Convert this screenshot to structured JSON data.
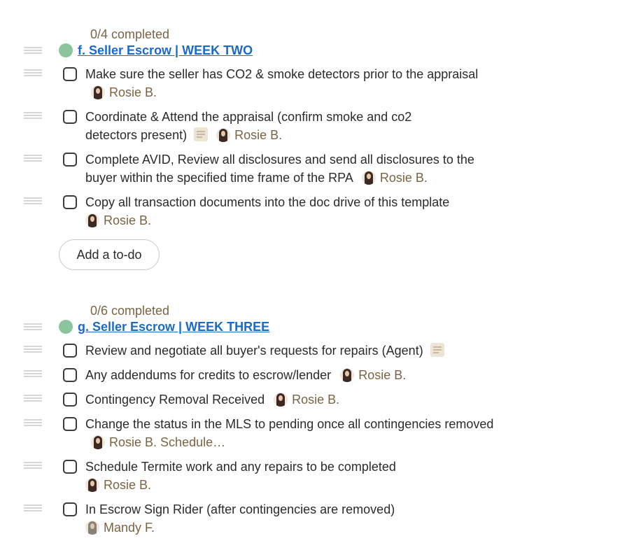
{
  "groups": [
    {
      "progress": "0/4 completed",
      "title": "f. Seller Escrow | WEEK TWO",
      "add_todo_label": "Add a to-do",
      "todos": [
        {
          "text": "Make sure the seller has CO2 & smoke detectors prior to the appraisal",
          "assignee": "Rosie B.",
          "has_note": false
        },
        {
          "text": "Coordinate & Attend the appraisal (confirm smoke and co2 detectors present)",
          "assignee": "Rosie B.",
          "has_note": true
        },
        {
          "text": "Complete AVID, Review all disclosures and send all disclosures to the buyer within the specified time frame of the RPA",
          "assignee": "Rosie B.",
          "has_note": false
        },
        {
          "text": "Copy all transaction documents into the doc drive of this template",
          "assignee": "Rosie B.",
          "has_note": false
        }
      ]
    },
    {
      "progress": "0/6 completed",
      "title": "g. Seller Escrow | WEEK THREE",
      "todos": [
        {
          "text": "Review and negotiate all buyer's requests for repairs (Agent)",
          "assignee": "",
          "has_note": true
        },
        {
          "text": "Any addendums for credits to escrow/lender",
          "assignee": "Rosie B.",
          "has_note": false
        },
        {
          "text": "Contingency Removal Received",
          "assignee": "Rosie B.",
          "has_note": false
        },
        {
          "text": "Change the status in the MLS to pending once all contingencies removed",
          "assignee": "Rosie B.",
          "extra": "Schedule…",
          "has_note": false
        },
        {
          "text": "Schedule Termite work and any repairs to be completed",
          "assignee": "Rosie B.",
          "has_note": false
        },
        {
          "text": "In Escrow Sign Rider (after contingencies are removed)",
          "assignee": "Mandy F.",
          "has_note": false
        }
      ]
    }
  ]
}
